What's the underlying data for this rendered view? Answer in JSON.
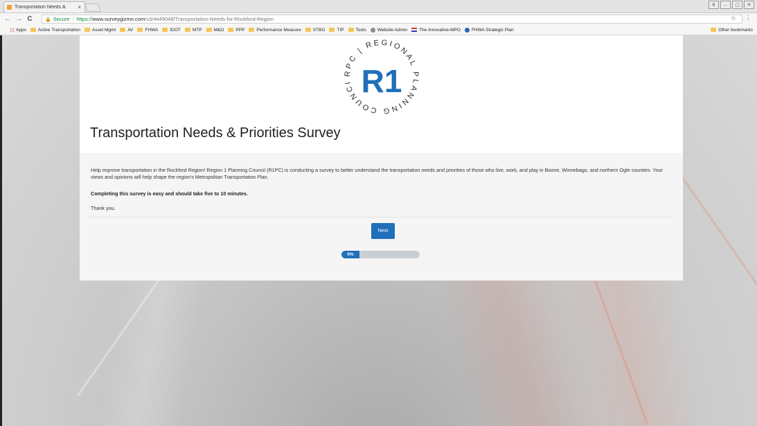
{
  "browser": {
    "tab_title": "Transportation Needs &",
    "tab_close": "×",
    "window_controls": [
      "8",
      "–",
      "▢",
      "✕"
    ],
    "nav": {
      "back": "←",
      "forward": "→",
      "reload": "C"
    },
    "address": {
      "secure_label": "Secure",
      "scheme": "https://",
      "host": "www.surveygizmo.com",
      "path": "/s3/4449048/Transportation-Needs-for-Rockford-Region"
    },
    "star": "☆",
    "menu": "⋮",
    "bookmarks": [
      {
        "label": "Apps",
        "icon": "apps-grid-icon"
      },
      {
        "label": "Active Transportation",
        "icon": "folder-icon"
      },
      {
        "label": "Asset Mgmt",
        "icon": "folder-icon"
      },
      {
        "label": "AV",
        "icon": "folder-icon"
      },
      {
        "label": "FHWA",
        "icon": "folder-icon"
      },
      {
        "label": "IDOT",
        "icon": "folder-icon"
      },
      {
        "label": "MTP",
        "icon": "folder-icon"
      },
      {
        "label": "M&O",
        "icon": "folder-icon"
      },
      {
        "label": "PPP",
        "icon": "folder-icon"
      },
      {
        "label": "Performance Measure",
        "icon": "folder-icon"
      },
      {
        "label": "STBG",
        "icon": "folder-icon"
      },
      {
        "label": "TIP",
        "icon": "folder-icon"
      },
      {
        "label": "Tools",
        "icon": "folder-icon"
      },
      {
        "label": "Website Admin",
        "icon": "site-icon"
      },
      {
        "label": "The-Innovative-MPO",
        "icon": "flag-icon"
      },
      {
        "label": "FHWA Strategic Plan",
        "icon": "globe-icon"
      }
    ],
    "other_bookmarks": "Other bookmarks"
  },
  "survey": {
    "logo": {
      "arc_text": "RPC | REGIONAL PLANNING COUNCIL |",
      "monogram": "R1"
    },
    "title": "Transportation Needs & Priorities Survey",
    "intro": "Help improve transportation in the Rockford Region! Region 1 Planning Council (R1PC) is conducting a survey to better understand the transportation needs and priorities of those who live, work, and play in Boone, Winnebago, and northern Ogle counties. Your views and opinions will help shape the region's Metropolitan Transportation Plan.",
    "bold_line": "Completing this survey is easy and should take five to 10 minutes.",
    "thanks": "Thank you.",
    "next_label": "Next",
    "progress_label": "0%",
    "progress_value": 0
  },
  "colors": {
    "accent": "#1f6fba",
    "progress_track": "#c9ced3",
    "secure_green": "#0a8a3a"
  }
}
